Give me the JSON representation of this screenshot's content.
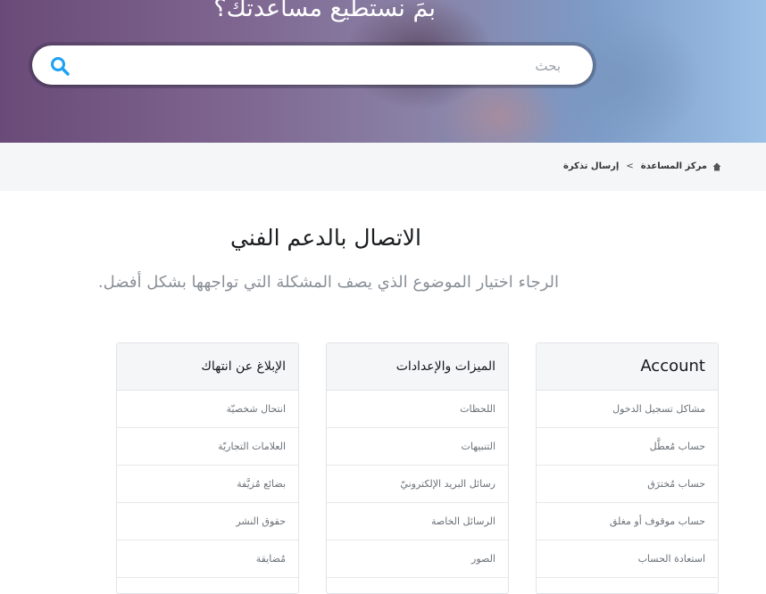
{
  "hero": {
    "title": "بمَ نستطيع مساعدتك؟",
    "search_placeholder": "بحث"
  },
  "breadcrumb": {
    "home": "مركز المساعدة",
    "separator": ">",
    "current": "إرسال تذكرة"
  },
  "main": {
    "title": "الاتصال بالدعم الفني",
    "subtitle": "الرجاء اختيار الموضوع الذي يصف المشكلة التي تواجهها بشكل أفضل."
  },
  "cards": [
    {
      "title": "Account",
      "items": [
        "مشاكل تسجيل الدخول",
        "حساب مُعطَّل",
        "حساب مُخترَق",
        "حساب موقوف أو مغلق",
        "استعادة الحساب"
      ]
    },
    {
      "title": "الميزات والإعدادات",
      "items": [
        "اللحظات",
        "التنبيهات",
        "رسائل البريد الإلكترونيّ",
        "الرسائل الخاصة",
        "الصور"
      ]
    },
    {
      "title": "الإبلاغ عن انتهاك",
      "items": [
        "انتحال شخصيّة",
        "العلامات التجاريّة",
        "بضائع مُزيَّفة",
        "حقوق النشر",
        "مُضايقة"
      ]
    }
  ],
  "colors": {
    "accent": "#1da1f2",
    "crumb_bg": "#f4f6f8",
    "muted_text": "#8a9099"
  }
}
